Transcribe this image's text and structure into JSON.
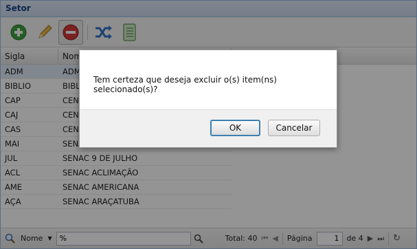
{
  "window": {
    "title": "Setor"
  },
  "toolbar": {
    "buttons": [
      {
        "name": "add",
        "icon": "add-circle-icon"
      },
      {
        "name": "edit",
        "icon": "pencil-icon"
      },
      {
        "name": "delete",
        "icon": "delete-circle-icon"
      },
      {
        "name": "shuffle",
        "icon": "shuffle-icon"
      },
      {
        "name": "notebook",
        "icon": "notebook-icon"
      }
    ]
  },
  "grid": {
    "columns": [
      "Sigla",
      "Nome"
    ],
    "rows": [
      {
        "sigla": "ADM",
        "nome": "ADM"
      },
      {
        "sigla": "BIBLIO",
        "nome": "BIBL"
      },
      {
        "sigla": "CAP",
        "nome": "CEN"
      },
      {
        "sigla": "CAJ",
        "nome": "CEN"
      },
      {
        "sigla": "CAS",
        "nome": "CEN"
      },
      {
        "sigla": "MAI",
        "nome": "SENA"
      },
      {
        "sigla": "JUL",
        "nome": "SENAC 9 DE JULHO"
      },
      {
        "sigla": "ACL",
        "nome": "SENAC ACLIMAÇÃO"
      },
      {
        "sigla": "AME",
        "nome": "SENAC AMERICANA"
      },
      {
        "sigla": "AÇA",
        "nome": "SENAC ARAÇATUBA"
      }
    ]
  },
  "bottom": {
    "filter_field": "Nome",
    "search_value": "%",
    "total": "Total: 40",
    "page_label": "Página",
    "page_value": "1",
    "page_of": "de 4"
  },
  "dialog": {
    "message": "Tem certeza que deseja excluir o(s) item(ns) selecionado(s)?",
    "ok_label": "OK",
    "cancel_label": "Cancelar"
  },
  "colors": {
    "title": "#15428b",
    "selected_row": "#dfe8f6",
    "ok_border": "#3c7fb1"
  }
}
